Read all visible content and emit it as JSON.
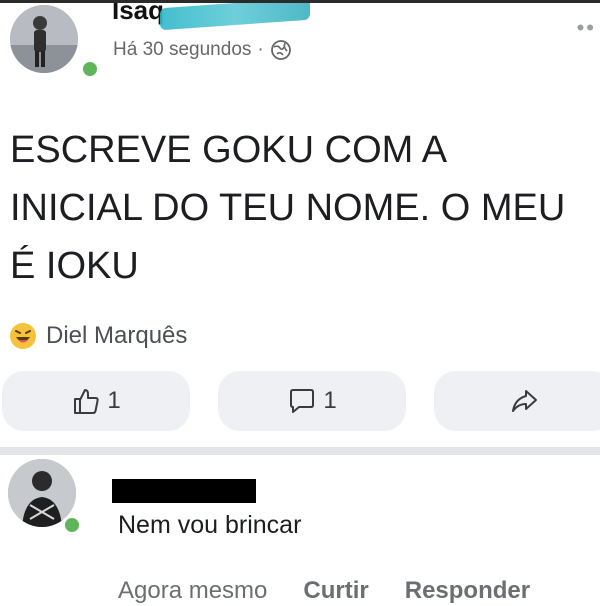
{
  "post": {
    "author_name": "Isaq",
    "timestamp": "Há 30 segundos",
    "separator": "·",
    "privacy_icon": "globe-icon",
    "more_icon": "more-dots-icon",
    "text": "ESCREVE GOKU COM A INICIAL DO TEU NOME. O MEU É IOKU"
  },
  "reaction": {
    "icon": "laughing-face-icon",
    "name": "Diel Marquês"
  },
  "actions": {
    "like_count": "1",
    "comment_count": "1",
    "like_icon": "thumbs-up-icon",
    "comment_icon": "comment-bubble-icon",
    "share_icon": "share-arrow-icon"
  },
  "comment": {
    "text": "Nem vou brincar",
    "time": "Agora mesmo",
    "like_label": "Curtir",
    "reply_label": "Responder"
  },
  "colors": {
    "online": "#5fb65a",
    "secondary_text": "#65676b",
    "action_bg": "#eef0f4"
  }
}
